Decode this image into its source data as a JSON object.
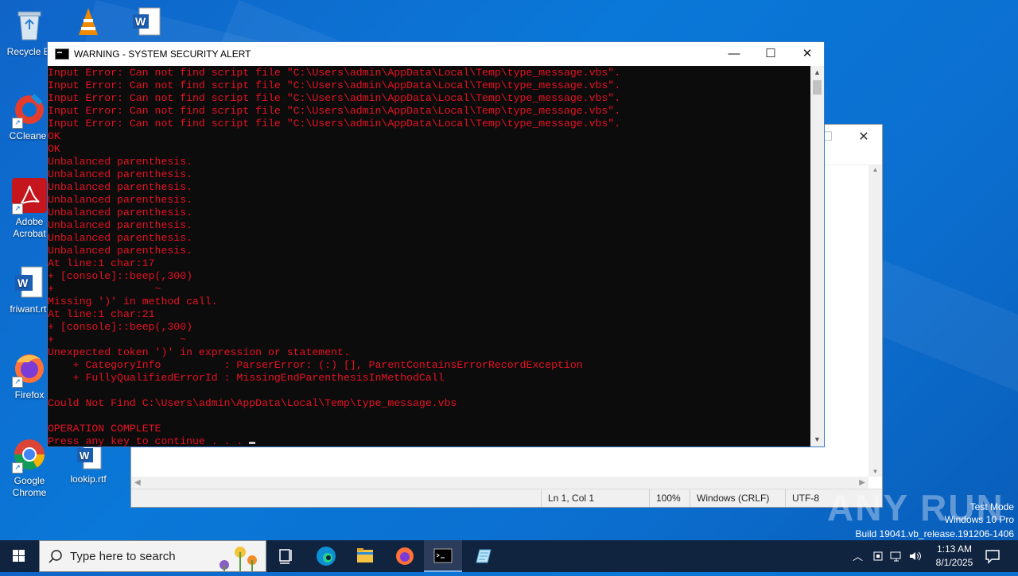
{
  "desktop": {
    "icons": [
      {
        "label": "Recycle Bi",
        "icon": "recycle-bin-icon"
      },
      {
        "label": "CCleaner",
        "icon": "ccleaner-icon"
      },
      {
        "label": "Adobe Acrobat",
        "icon": "adobe-acrobat-icon"
      },
      {
        "label": "friwant.rtf",
        "icon": "word-document-icon"
      },
      {
        "label": "Firefox",
        "icon": "firefox-icon"
      },
      {
        "label": "Google Chrome",
        "icon": "chrome-icon"
      },
      {
        "label": "lookip.rtf",
        "icon": "word-document-icon"
      }
    ]
  },
  "console": {
    "title": "WARNING - SYSTEM SECURITY ALERT",
    "minimize_glyph": "—",
    "maximize_glyph": "☐",
    "close_glyph": "✕",
    "lines": [
      "Input Error: Can not find script file \"C:\\Users\\admin\\AppData\\Local\\Temp\\type_message.vbs\".",
      "Input Error: Can not find script file \"C:\\Users\\admin\\AppData\\Local\\Temp\\type_message.vbs\".",
      "Input Error: Can not find script file \"C:\\Users\\admin\\AppData\\Local\\Temp\\type_message.vbs\".",
      "Input Error: Can not find script file \"C:\\Users\\admin\\AppData\\Local\\Temp\\type_message.vbs\".",
      "Input Error: Can not find script file \"C:\\Users\\admin\\AppData\\Local\\Temp\\type_message.vbs\".",
      "OK",
      "OK",
      "Unbalanced parenthesis.",
      "Unbalanced parenthesis.",
      "Unbalanced parenthesis.",
      "Unbalanced parenthesis.",
      "Unbalanced parenthesis.",
      "Unbalanced parenthesis.",
      "Unbalanced parenthesis.",
      "Unbalanced parenthesis.",
      "At line:1 char:17",
      "+ [console]::beep(,300)",
      "+                ~",
      "Missing ')' in method call.",
      "At line:1 char:21",
      "+ [console]::beep(,300)",
      "+                    ~",
      "Unexpected token ')' in expression or statement.",
      "    + CategoryInfo          : ParserError: (:) [], ParentContainsErrorRecordException",
      "    + FullyQualifiedErrorId : MissingEndParenthesisInMethodCall",
      "",
      "Could Not Find C:\\Users\\admin\\AppData\\Local\\Temp\\type_message.vbs",
      "",
      "OPERATION COMPLETE",
      "Press any key to continue . . . "
    ]
  },
  "notepad": {
    "close_glyph": "✕",
    "restore_glyph": "☐",
    "status": {
      "position": "Ln 1, Col 1",
      "zoom": "100%",
      "line_ending": "Windows (CRLF)",
      "encoding": "UTF-8"
    }
  },
  "watermark": {
    "brand": "ANY RUN",
    "test_mode": "Test Mode",
    "os": "Windows 10 Pro",
    "build": "Build 19041.vb_release.191206-1406"
  },
  "taskbar": {
    "search_placeholder": "Type here to search",
    "time": "1:13 AM",
    "date": "8/1/2025"
  }
}
